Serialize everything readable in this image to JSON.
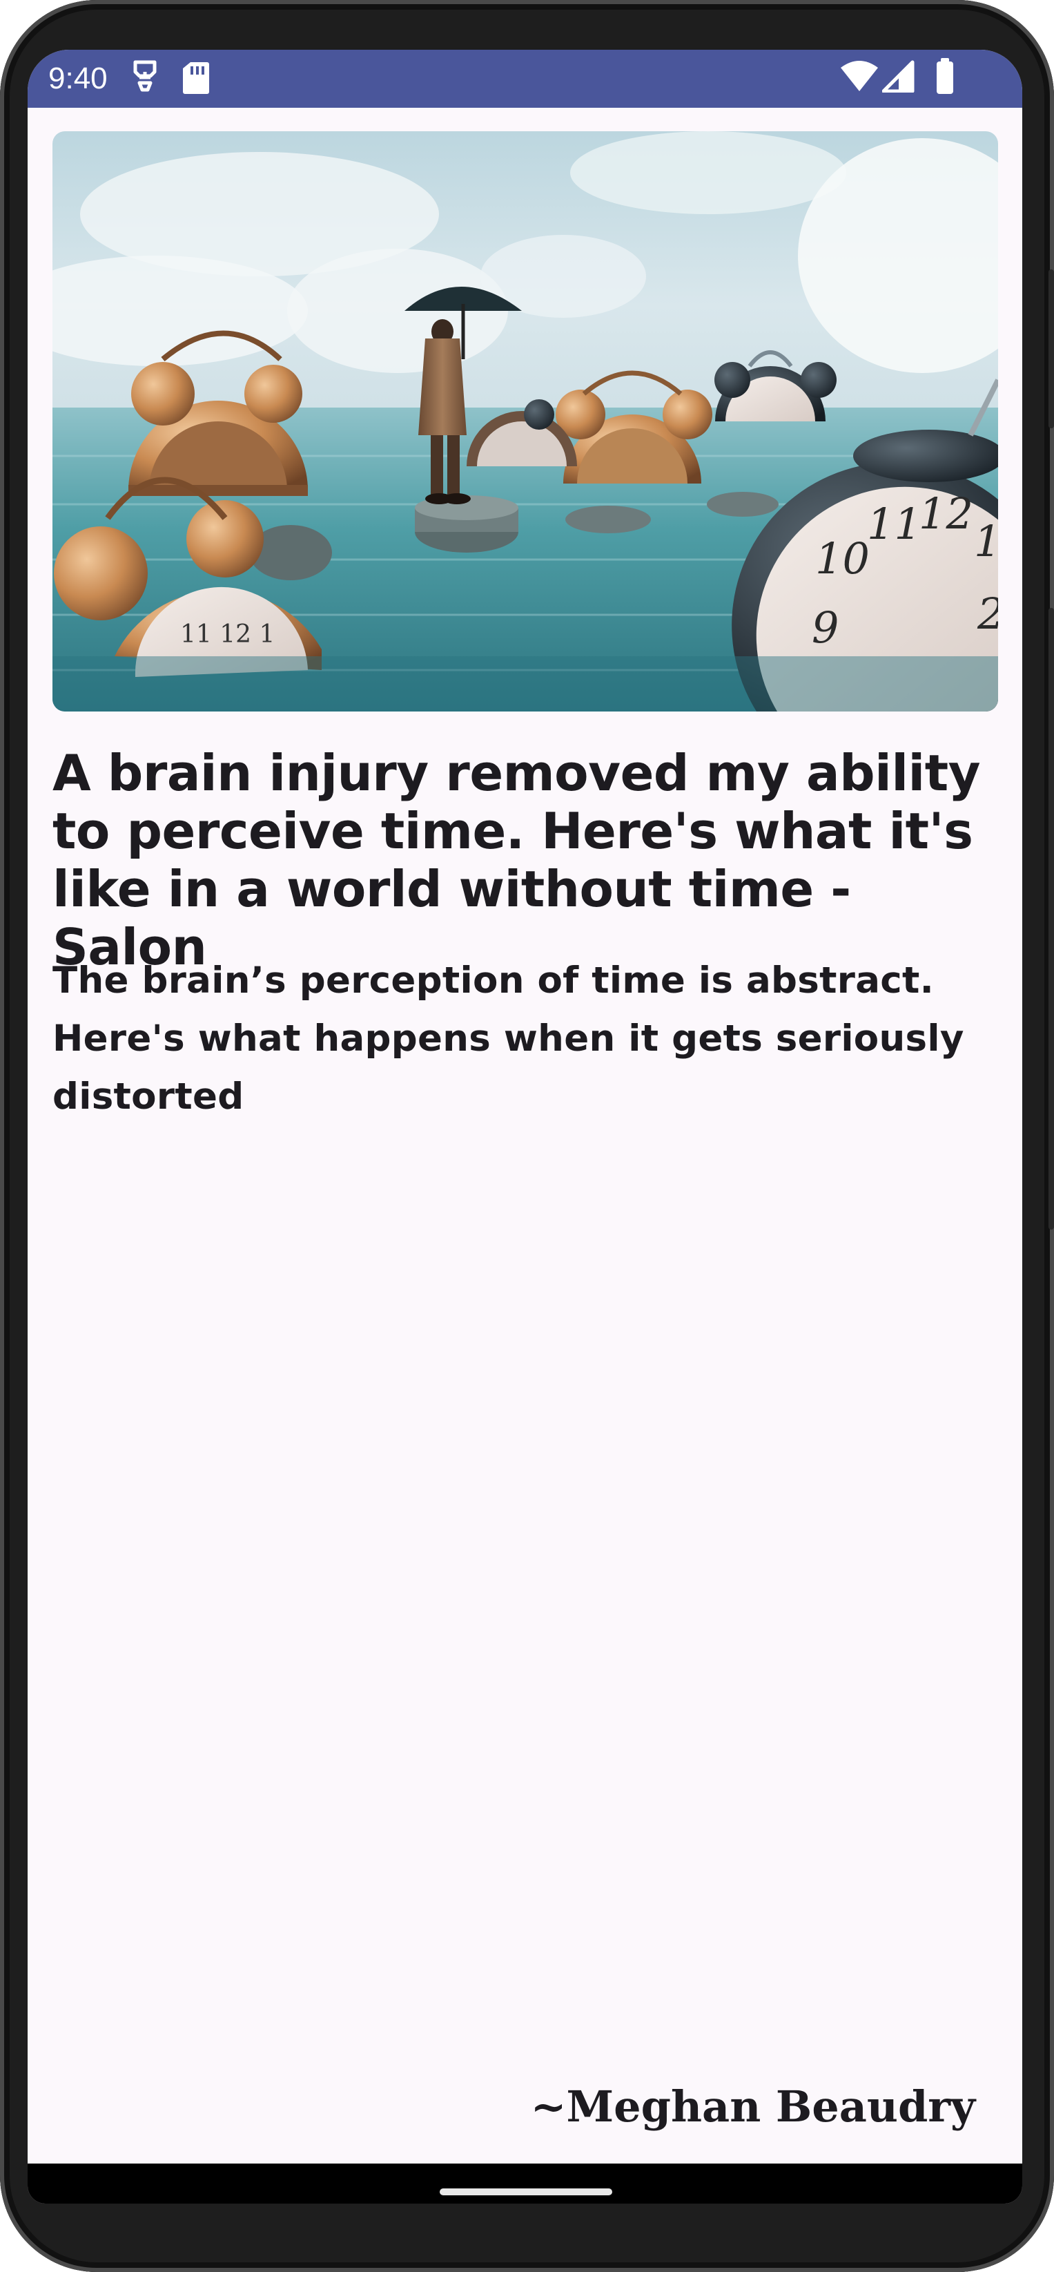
{
  "status_bar": {
    "time": "9:40",
    "icons": [
      "sim-toolkit-icon",
      "sd-card-icon",
      "wifi-icon",
      "cell-signal-icon",
      "battery-icon"
    ],
    "background": "#4a569b"
  },
  "article": {
    "image_alt": "A man with an umbrella standing among giant alarm clocks half-submerged in water",
    "title": "A brain injury removed my ability to perceive time. Here's what it's like in a world without time - Salon",
    "description": "The brain’s perception of time is abstract. Here's what happens when it gets seriously distorted",
    "author": "~Meghan Beaudry"
  },
  "colors": {
    "screen_background": "#fcf8fc",
    "text": "#1d1b20",
    "accent": "#4a569b"
  }
}
